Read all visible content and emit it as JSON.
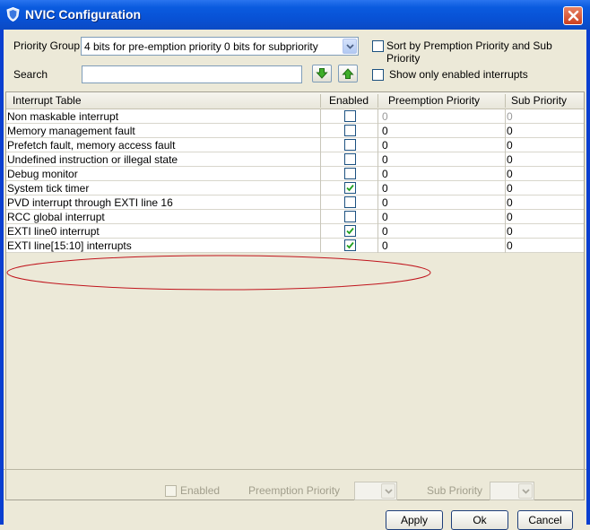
{
  "window": {
    "title": "NVIC Configuration"
  },
  "top": {
    "priority_group_label": "Priority Group",
    "priority_group_value": "4 bits for pre-emption priority 0 bits for subpriority",
    "sort_label": "Sort by Premption Priority and Sub Priority",
    "search_label": "Search",
    "search_value": "",
    "show_enabled_label": "Show only enabled interrupts"
  },
  "table": {
    "headers": [
      "Interrupt Table",
      "Enabled",
      "Preemption Priority",
      "Sub Priority"
    ],
    "rows": [
      {
        "name": "Non maskable interrupt",
        "enabled": false,
        "preemption": "0",
        "sub": "0",
        "readonly": true
      },
      {
        "name": "Memory management fault",
        "enabled": false,
        "preemption": "0",
        "sub": "0",
        "readonly": false
      },
      {
        "name": "Prefetch fault, memory access fault",
        "enabled": false,
        "preemption": "0",
        "sub": "0",
        "readonly": false
      },
      {
        "name": "Undefined instruction or illegal state",
        "enabled": false,
        "preemption": "0",
        "sub": "0",
        "readonly": false
      },
      {
        "name": "Debug monitor",
        "enabled": false,
        "preemption": "0",
        "sub": "0",
        "readonly": false
      },
      {
        "name": "System tick timer",
        "enabled": true,
        "preemption": "0",
        "sub": "0",
        "readonly": false
      },
      {
        "name": "PVD interrupt through EXTI line 16",
        "enabled": false,
        "preemption": "0",
        "sub": "0",
        "readonly": false
      },
      {
        "name": "RCC global interrupt",
        "enabled": false,
        "preemption": "0",
        "sub": "0",
        "readonly": false
      },
      {
        "name": "EXTI line0 interrupt",
        "enabled": true,
        "preemption": "0",
        "sub": "0",
        "readonly": false
      },
      {
        "name": "EXTI line[15:10] interrupts",
        "enabled": true,
        "preemption": "0",
        "sub": "0",
        "readonly": false
      }
    ]
  },
  "bottom": {
    "enabled_label": "Enabled",
    "preemption_label": "Preemption Priority",
    "sub_label": "Sub Priority",
    "apply_label": "Apply",
    "ok_label": "Ok",
    "cancel_label": "Cancel"
  },
  "colors": {
    "titlebar": "#0852d6",
    "annotation": "#c0141c",
    "check": "#21a121"
  }
}
